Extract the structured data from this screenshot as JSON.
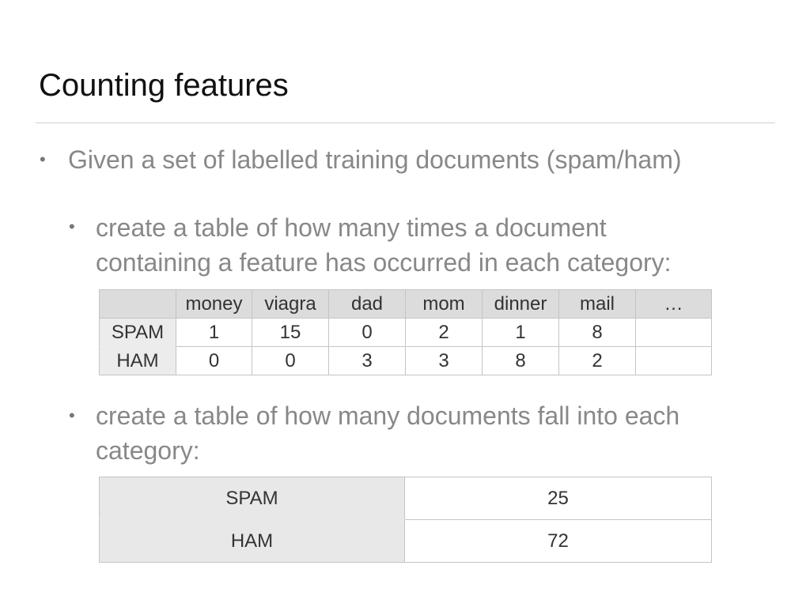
{
  "slide": {
    "title": "Counting features"
  },
  "bullets": [
    {
      "marker": "•",
      "text": "Given a set of labelled training documents (spam/ham)"
    },
    {
      "marker": "•",
      "lines": [
        "create a table of how many times a document",
        "containing a feature has occurred in each category:"
      ]
    },
    {
      "marker": "•",
      "lines": [
        "create a table of how many documents fall into each",
        "category:"
      ]
    }
  ],
  "feature_table": {
    "columns": [
      "",
      "money",
      "viagra",
      "dad",
      "mom",
      "dinner",
      "mail",
      "…"
    ],
    "rows": [
      {
        "label": "SPAM",
        "values": [
          "1",
          "15",
          "0",
          "2",
          "1",
          "8",
          ""
        ]
      },
      {
        "label": "HAM",
        "values": [
          "0",
          "0",
          "3",
          "3",
          "8",
          "2",
          ""
        ]
      }
    ]
  },
  "category_table": {
    "rows": [
      {
        "label": "SPAM",
        "count": "25"
      },
      {
        "label": "HAM",
        "count": "72"
      }
    ]
  },
  "colors": {
    "title": "#111111",
    "bullet_text": "#888888",
    "table_header_bg": "#dcdcdc",
    "row_label_bg": "#ececec",
    "table_border": "#c4c4c4"
  }
}
